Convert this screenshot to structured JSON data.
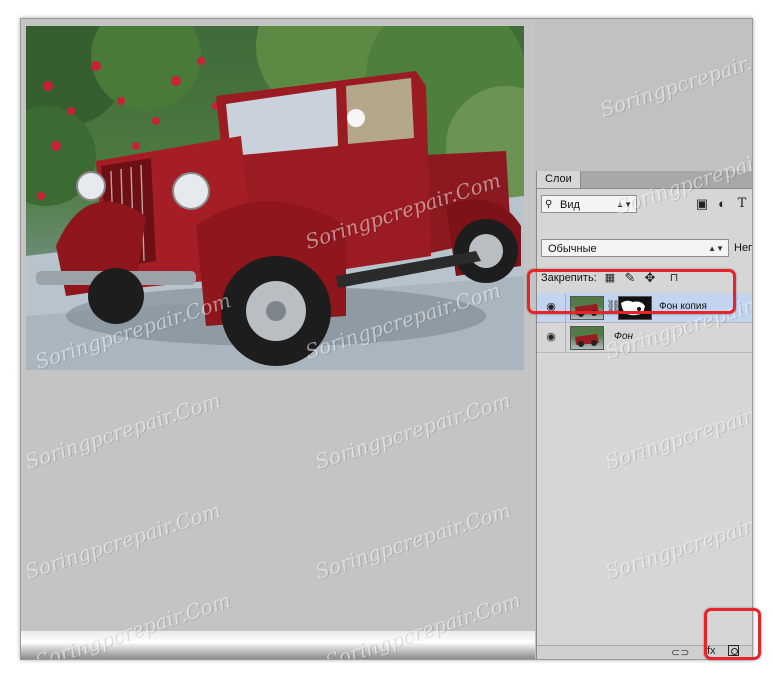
{
  "panel": {
    "tab_label": "Слои",
    "filter_select": "Вид",
    "blend_mode": "Обычные",
    "opacity_label_partial": "Неп",
    "lock_label": "Закрепить:"
  },
  "layers": [
    {
      "name": "Фон копия",
      "selected": true,
      "has_mask": true
    },
    {
      "name": "Фон",
      "selected": false,
      "has_mask": false
    }
  ],
  "watermark": "Soringpcrepair.Com",
  "colors": {
    "highlight": "#e8232a",
    "selected_row": "#c2d4ef",
    "car_red": "#9b1b22"
  },
  "icons": {
    "filter_search": "search-icon",
    "filter_image": "image-filter-icon",
    "filter_adjust": "adjustment-filter-icon",
    "filter_text": "text-filter-icon",
    "lock_pixels": "lock-transparent-icon",
    "lock_brush": "brush-icon",
    "lock_move": "move-icon",
    "lock_all": "lock-icon",
    "footer_link": "link-layers-icon",
    "footer_fx": "fx-icon",
    "footer_mask": "add-mask-icon"
  }
}
